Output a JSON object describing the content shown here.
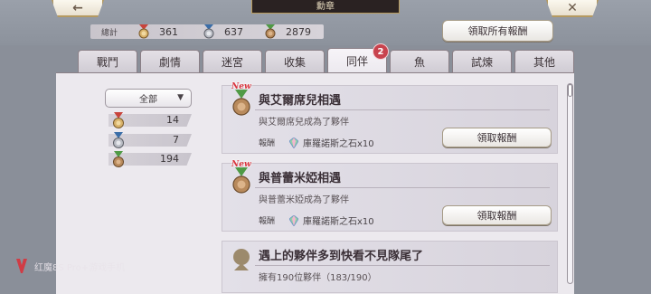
{
  "header": {
    "title": "勳章",
    "back_icon": "←",
    "close_icon": "✕"
  },
  "summary": {
    "label": "總計",
    "stats": [
      {
        "icon": "medal-gold-icon",
        "value": "361",
        "ribbon": "#c8443c"
      },
      {
        "icon": "medal-silver-icon",
        "value": "637",
        "ribbon": "#3b6ea8"
      },
      {
        "icon": "medal-bronze-icon",
        "value": "2879",
        "ribbon": "#4f9a45"
      }
    ],
    "claim_all_label": "領取所有報酬"
  },
  "tabs": [
    {
      "label": "戰鬥",
      "active": false
    },
    {
      "label": "劇情",
      "active": false
    },
    {
      "label": "迷宮",
      "active": false
    },
    {
      "label": "收集",
      "active": false
    },
    {
      "label": "同伴",
      "active": true,
      "badge": "2"
    },
    {
      "label": "魚",
      "active": false
    },
    {
      "label": "試煉",
      "active": false
    },
    {
      "label": "其他",
      "active": false
    }
  ],
  "filter": {
    "selected": "全部",
    "counts": [
      {
        "icon": "medal-gold-icon",
        "value": "14",
        "ribbon": "#c8443c"
      },
      {
        "icon": "medal-silver-icon",
        "value": "7",
        "ribbon": "#3b6ea8"
      },
      {
        "icon": "medal-bronze-icon",
        "value": "194",
        "ribbon": "#4f9a45"
      }
    ]
  },
  "achievements": [
    {
      "new_tag": "New",
      "title": "與艾爾席兒相遇",
      "description": "與艾爾席兒成為了夥伴",
      "reward_label": "報酬",
      "reward": "庫羅諾斯之石x10",
      "claim_label": "領取報酬"
    },
    {
      "new_tag": "New",
      "title": "與普蕾米婭相遇",
      "description": "與普蕾米婭成為了夥伴",
      "reward_label": "報酬",
      "reward": "庫羅諾斯之石x10",
      "claim_label": "領取報酬"
    },
    {
      "title": "遇上的夥伴多到快看不見隊尾了",
      "description": "擁有190位夥伴（183/190）"
    }
  ],
  "watermark": "红魔8S Pro+游戏手机",
  "colors": {
    "accent_red": "#c8434e",
    "panel_bg": "#ece9ee"
  }
}
